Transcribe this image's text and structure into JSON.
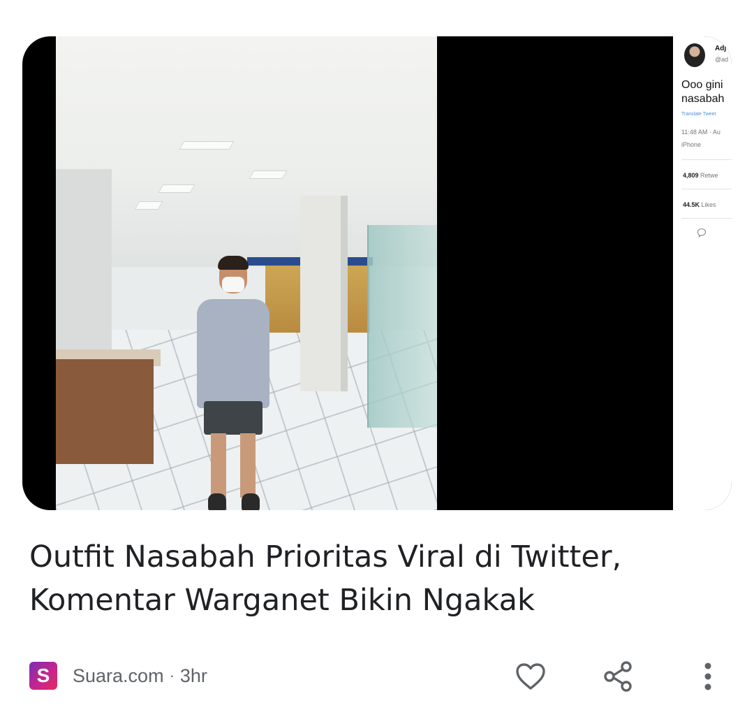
{
  "article": {
    "headline": "Outfit Nasabah Prioritas Viral di Twitter, Komentar Warganet Bikin Ngakak",
    "source_logo_letter": "S",
    "source": "Suara.com",
    "separator": "·",
    "age": "3hr"
  },
  "tweet": {
    "user": "Adj",
    "handle": "@ad",
    "text": "Ooo gini\nnasabah",
    "translate": "Translate Tweet",
    "time": "11:48 AM · Au",
    "device": "iPhone",
    "retweets_count": "4,809",
    "retweets_label": "Retwe",
    "likes_count": "44.5K",
    "likes_label": "Likes"
  },
  "actions": {
    "like_icon": "heart-outline-icon",
    "share_icon": "share-icon",
    "more_icon": "more-vertical-icon"
  },
  "colors": {
    "headline": "#202124",
    "meta": "#5f6368",
    "logo_gradient_start": "#7b2fb1",
    "logo_gradient_end": "#e6295e"
  }
}
